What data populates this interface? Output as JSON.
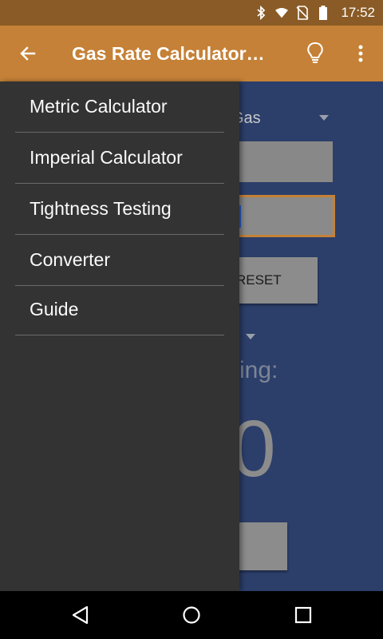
{
  "status_bar": {
    "time": "17:52",
    "icons": [
      "bluetooth-icon",
      "wifi-icon",
      "no-sim-icon",
      "battery-icon"
    ],
    "color": "#8a5b26"
  },
  "app_bar": {
    "title": "Gas Rate Calculator…",
    "color": "#c58137",
    "icons": [
      "back-arrow-icon",
      "lightbulb-icon",
      "more-vert-icon"
    ]
  },
  "background": {
    "gas_type": "l Gas",
    "reset_label": "RESET",
    "reading_label": "ing:",
    "reading_value": "0",
    "color": "#2c3f6b"
  },
  "drawer": {
    "items": [
      {
        "label": "Metric Calculator"
      },
      {
        "label": "Imperial Calculator"
      },
      {
        "label": "Tightness Testing"
      },
      {
        "label": "Converter"
      },
      {
        "label": "Guide"
      }
    ]
  },
  "nav_bar": {
    "icons": [
      "back-triangle-icon",
      "home-circle-icon",
      "recents-square-icon"
    ]
  }
}
